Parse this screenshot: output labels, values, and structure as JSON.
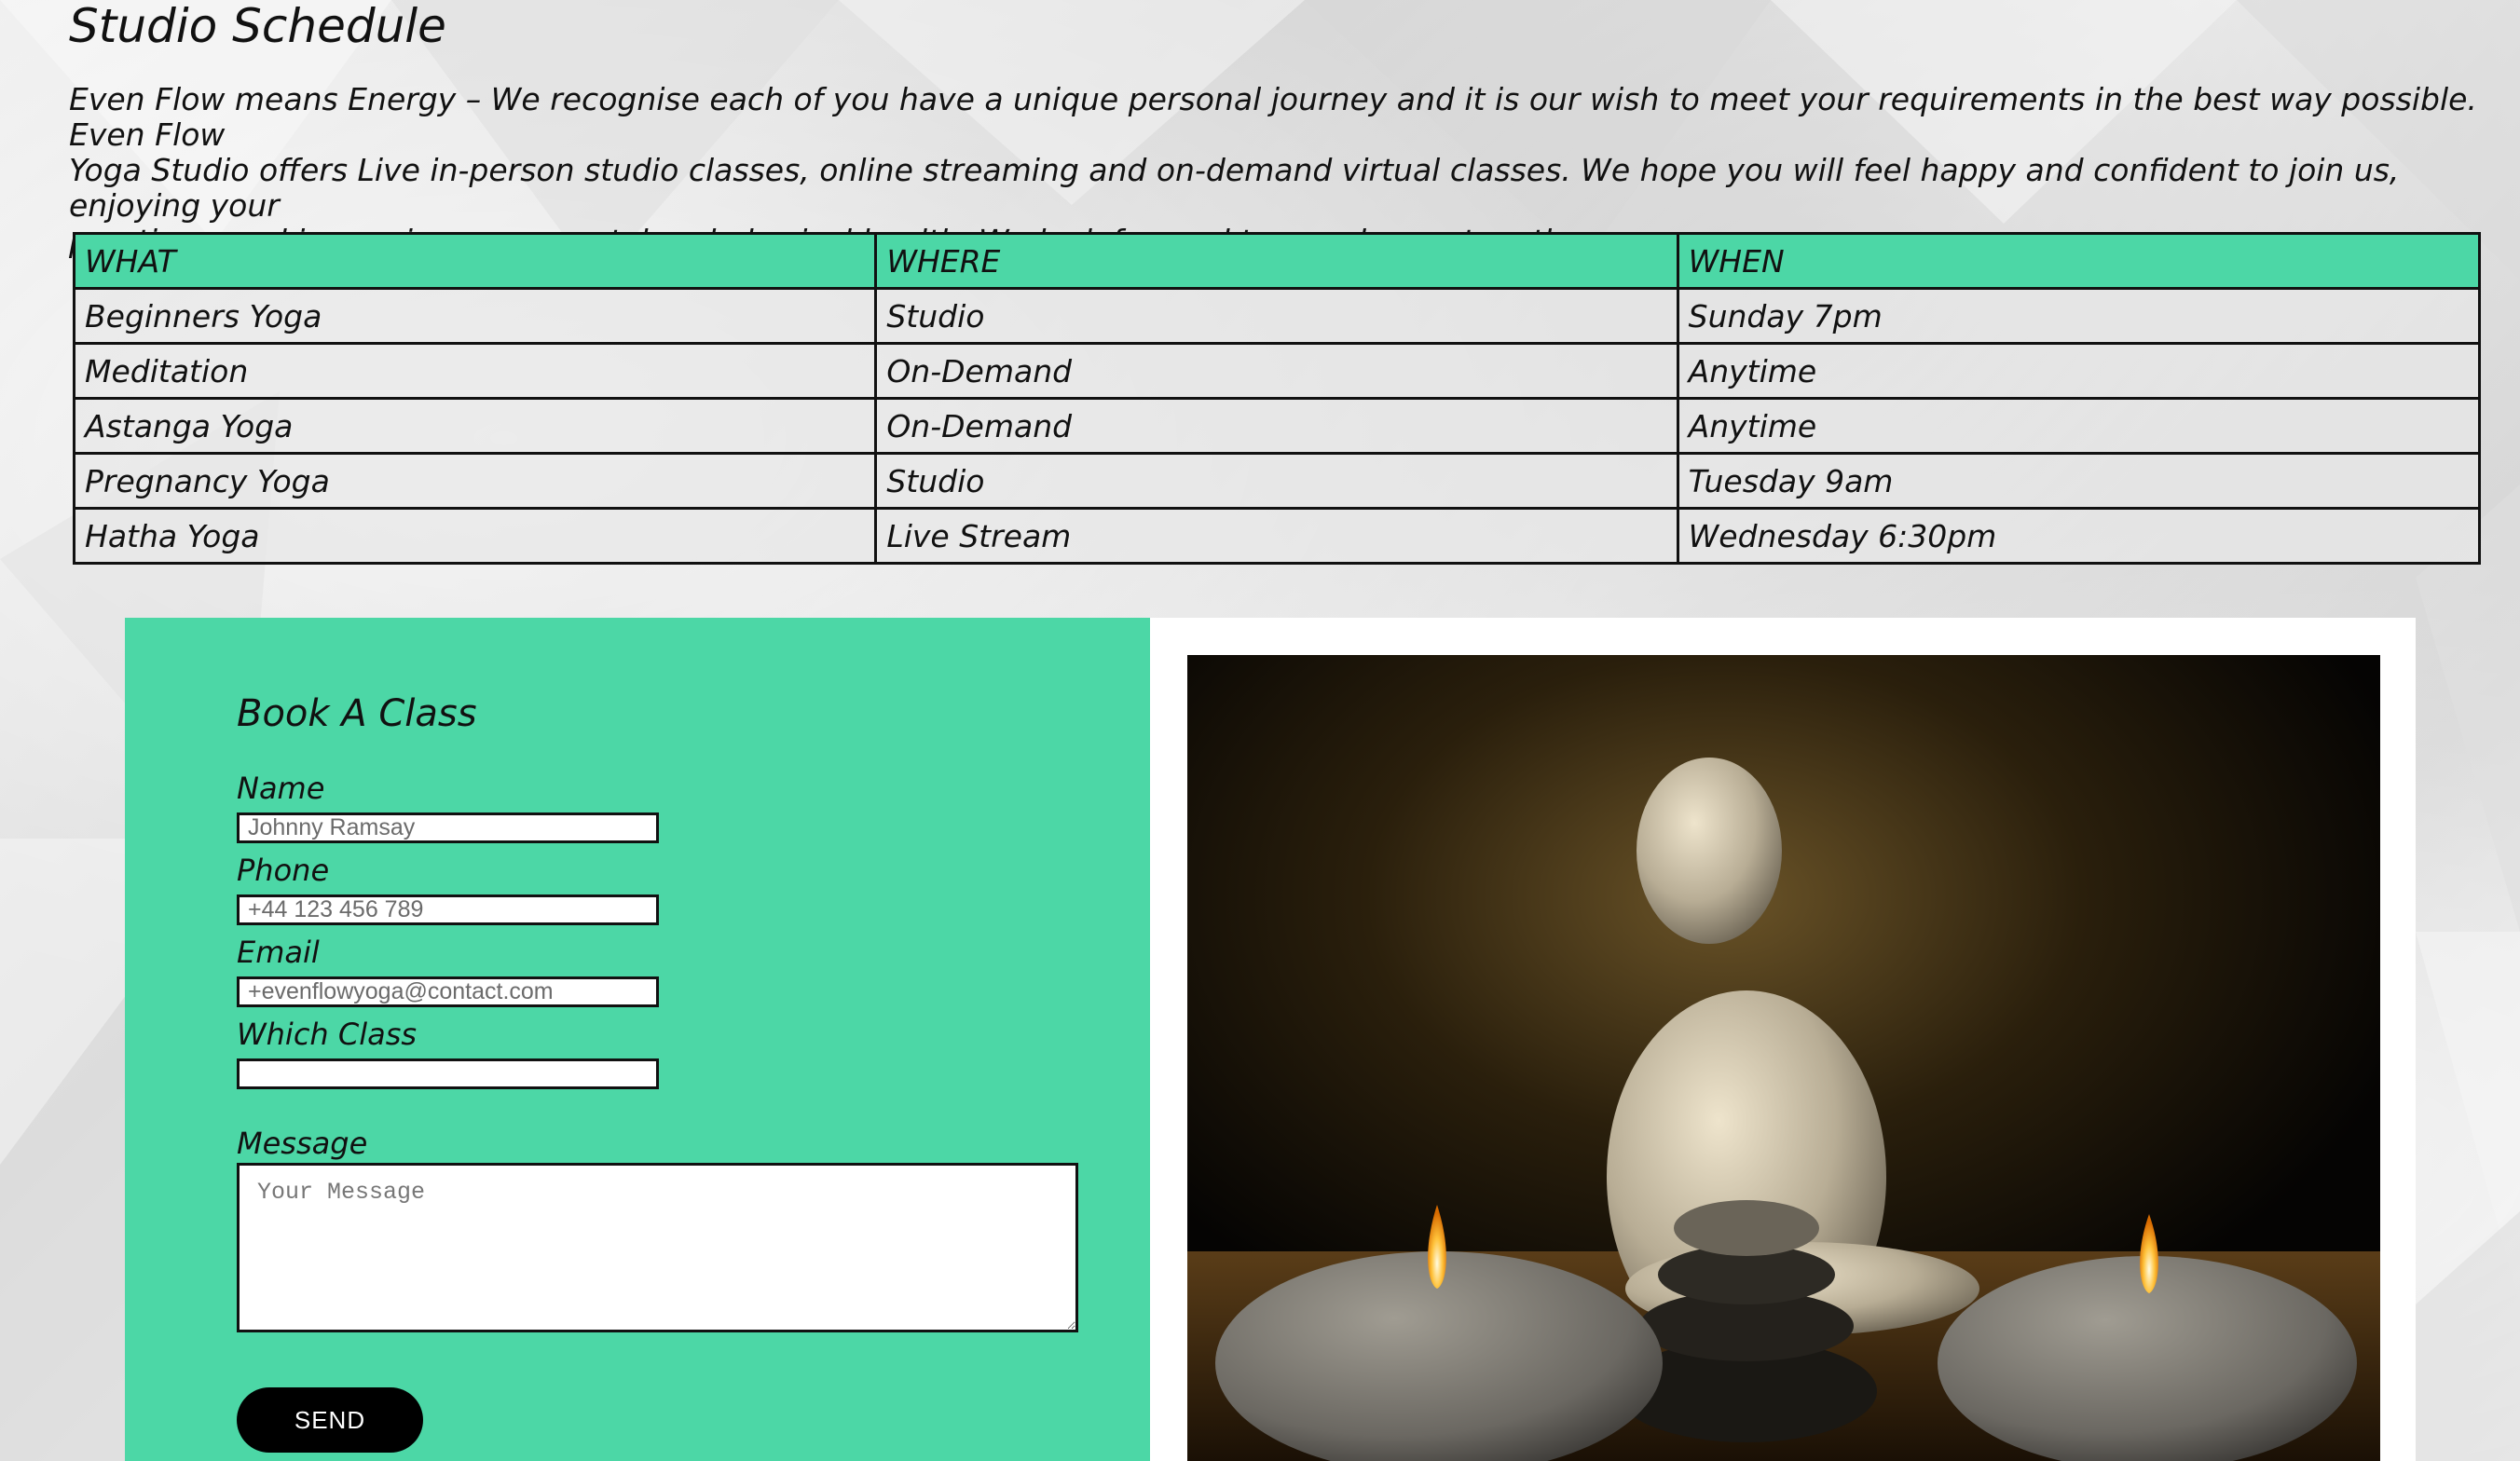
{
  "page": {
    "title": "Studio Schedule",
    "intro": "Even Flow means Energy – We recognise each of you have a unique personal journey and it is our wish to meet your requirements in the best way possible. Even Flow\nYoga Studio offers Live in-person studio classes, online streaming and on-demand virtual classes. We hope you will feel happy and confident to join us, enjoying your\npractices, and improving your mental and physical health. We look forward to our classes together."
  },
  "schedule": {
    "headers": [
      "WHAT",
      "WHERE",
      "WHEN"
    ],
    "rows": [
      [
        "Beginners Yoga",
        "Studio",
        "Sunday 7pm"
      ],
      [
        "Meditation",
        "On-Demand",
        "Anytime"
      ],
      [
        "Astanga Yoga",
        "On-Demand",
        "Anytime"
      ],
      [
        "Pregnancy Yoga",
        "Studio",
        "Tuesday 9am"
      ],
      [
        "Hatha Yoga",
        "Live Stream",
        "Wednesday 6:30pm"
      ]
    ]
  },
  "booking": {
    "title": "Book A Class",
    "name_label": "Name",
    "name_placeholder": "Johnny Ramsay",
    "phone_label": "Phone",
    "phone_placeholder": "+44 123 456 789",
    "email_label": "Email",
    "email_placeholder": "+evenflowyoga@contact.com",
    "class_label": "Which Class",
    "class_placeholder": "",
    "message_label": "Message",
    "message_placeholder": "Your Message",
    "send_label": "SEND"
  },
  "colors": {
    "accent": "#4cd7a6",
    "button": "#000000"
  },
  "image": {
    "name": "buddha-candles-photo"
  }
}
